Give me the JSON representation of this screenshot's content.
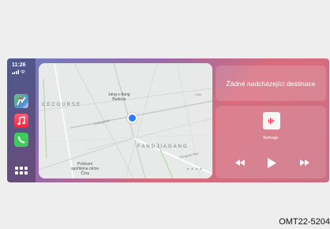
{
  "status_bar": {
    "time": "11:26",
    "signal_icon": "signal-bars-icon",
    "wifi_icon": "wifi-icon"
  },
  "dock": {
    "apps": [
      {
        "name": "Maps",
        "icon": "maps-icon"
      },
      {
        "name": "Music",
        "icon": "music-note-icon"
      },
      {
        "name": "Phone",
        "icon": "phone-icon"
      }
    ],
    "home_icon": "app-grid-icon"
  },
  "map": {
    "labels": {
      "poi_a": "Jang-c-tlang\nBudova",
      "poi_b": "Poštovní\nspořitelna mimo\nČína",
      "road_a": "Changchun",
      "road_b": "Gangyan Roe",
      "road_c": "Chin",
      "district_a": "CECOURSE",
      "district_b": "FANGJIAGANG",
      "scale": "■ ■ ■ ■"
    }
  },
  "navigation": {
    "destination_text": "Žádné nadcházející destinace"
  },
  "now_playing": {
    "status": "Nehraje",
    "controls": [
      "rewind-icon",
      "play-icon",
      "fast-forward-icon"
    ]
  },
  "figure_code": "OMT22-5204",
  "colors": {
    "accent_blue": "#2e7cf6",
    "music_red": "#fa233b",
    "phone_green": "#3ecb5b"
  }
}
